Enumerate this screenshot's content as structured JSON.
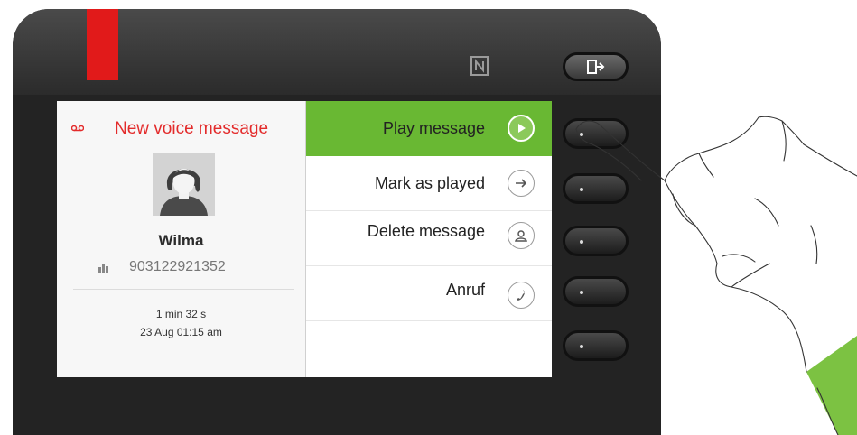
{
  "colors": {
    "accent_green": "#69b833",
    "alert_red": "#e32b2b",
    "led_red": "#e11a1a"
  },
  "device": {
    "top_icons": [
      "nfc-icon",
      "exit-icon"
    ],
    "softkey_count": 5
  },
  "voice_message": {
    "title": "New voice message",
    "caller_name": "Wilma",
    "number": "903122921352",
    "duration": "1 min 32 s",
    "date": "23 Aug 01:15 am"
  },
  "menu": {
    "items": [
      {
        "label": "Play message",
        "icon": "play-icon",
        "active": true
      },
      {
        "label": "Mark as played",
        "icon": "arrow-right-icon",
        "active": false
      },
      {
        "label": "Delete message",
        "icon": "person-icon",
        "active": false
      },
      {
        "label": "Anruf",
        "icon": "phone-icon",
        "active": false
      },
      {
        "label": "",
        "icon": "",
        "active": false
      }
    ]
  }
}
